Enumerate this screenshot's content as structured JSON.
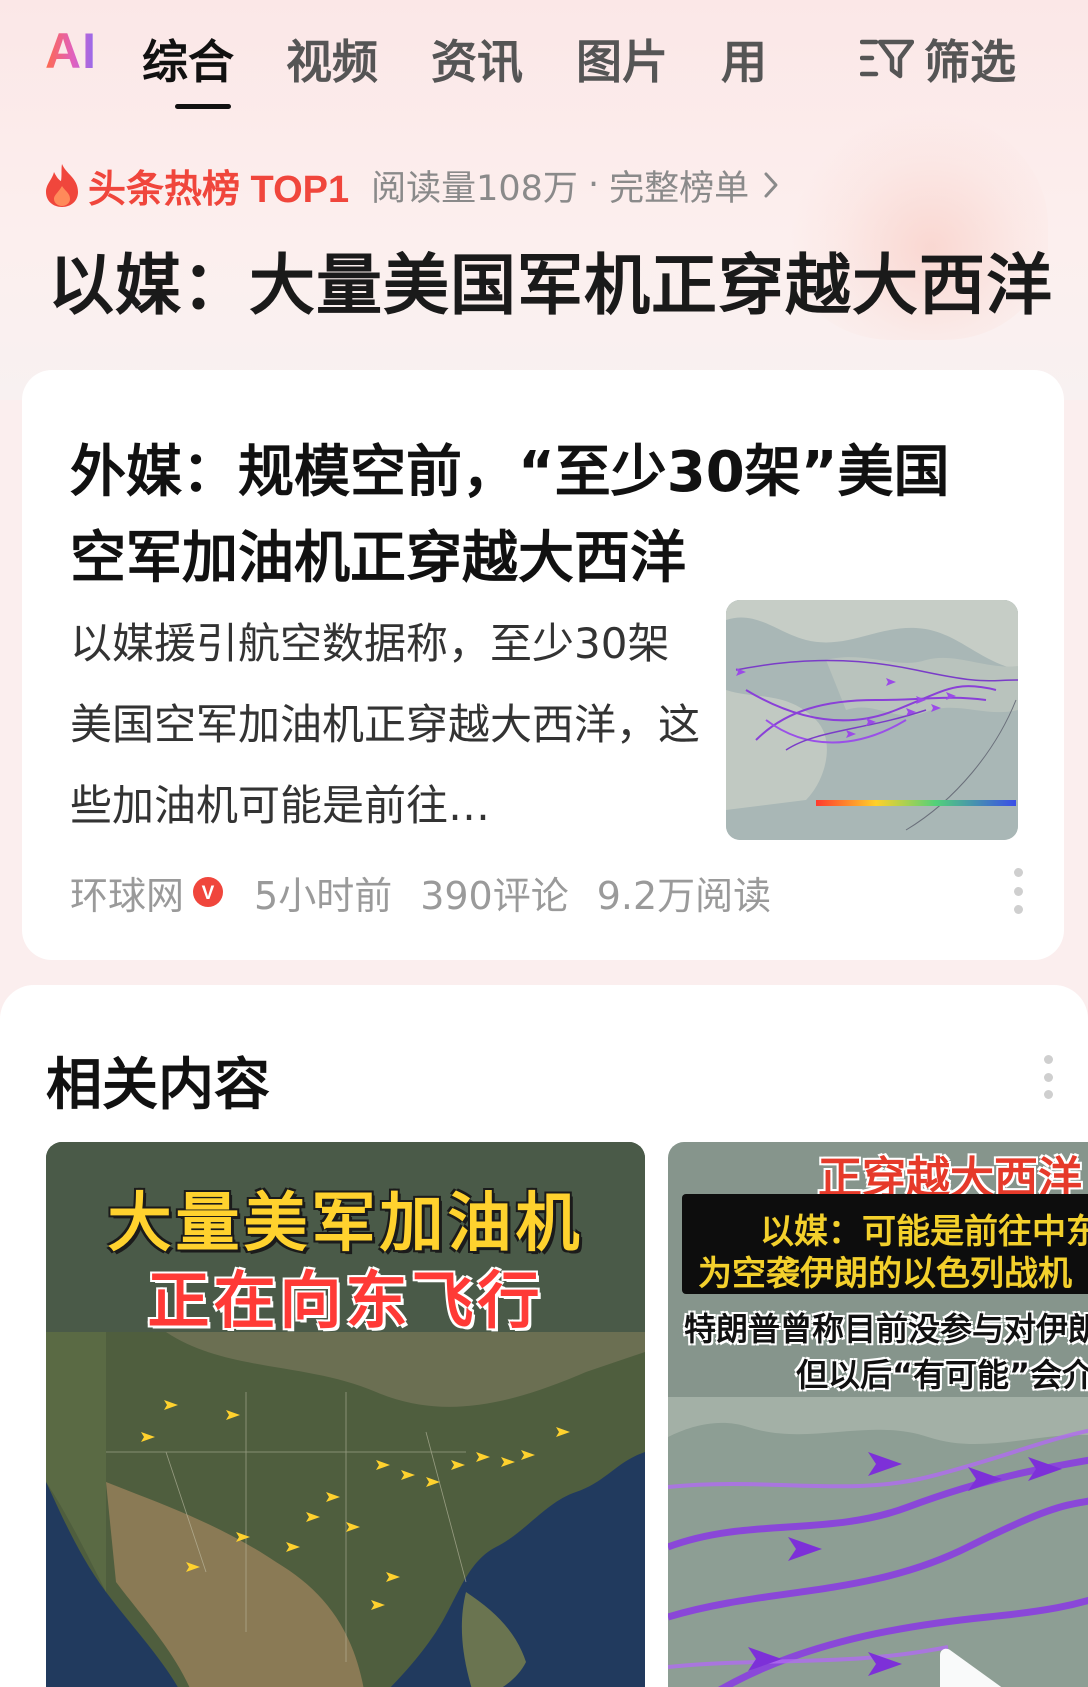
{
  "tabs": {
    "ai_logo": "AI",
    "items": [
      "综合",
      "视频",
      "资讯",
      "图片",
      "用"
    ],
    "filter_label": "筛选"
  },
  "hot": {
    "label": "头条热榜 TOP1",
    "reads": "阅读量108万",
    "separator": "·",
    "full_list": "完整榜单",
    "headline": "以媒：大量美国军机正穿越大西洋"
  },
  "article": {
    "title": "外媒：规模空前，“至少30架”美国空军加油机正穿越大西洋",
    "summary": "以媒援引航空数据称，至少30架美国空军加油机正穿越大西洋，这些加油机可能是前往…",
    "source": "环球网",
    "verified_mark": "V",
    "time": "5小时前",
    "comments": "390评论",
    "reads": "9.2万阅读"
  },
  "related": {
    "title": "相关内容",
    "video1": {
      "line1": "大量美军加油机",
      "line2": "正在向东飞行"
    },
    "video2": {
      "banner": "正穿越大西洋",
      "box_line1": "以媒：可能是前往中东",
      "box_line2": "为空袭伊朗的以色列战机",
      "sub_line1": "特朗普曾称目前没参与对伊朗",
      "sub_line2": "但以后“有可能”会介"
    }
  },
  "colors": {
    "accent_red": "#f0463c",
    "text_primary": "#111111",
    "text_meta": "#9a9a9a",
    "page_bg": "#fbeeee"
  }
}
